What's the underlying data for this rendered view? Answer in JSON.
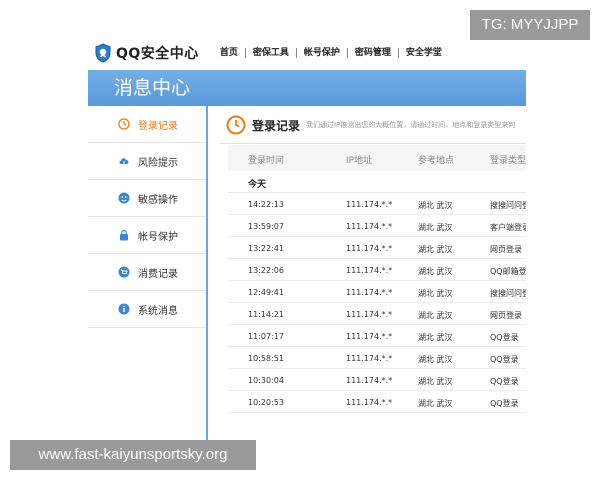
{
  "watermarks": {
    "top": "TG: MYYJJPP",
    "bottom": "www.fast-kaiyunsportsky.org"
  },
  "header": {
    "logo_text": "QQ安全中心",
    "nav": [
      "首页",
      "密保工具",
      "帐号保护",
      "密码管理",
      "安全学堂"
    ]
  },
  "banner": {
    "title": "消息中心"
  },
  "colors": {
    "accent": "#ee7a1a",
    "banner": "#5a98d8",
    "divider": "#6aa6e0"
  },
  "sidebar": {
    "items": [
      {
        "label": "登录记录",
        "icon": "clock-icon",
        "active": true
      },
      {
        "label": "风险提示",
        "icon": "cloud-icon",
        "active": false
      },
      {
        "label": "敏感操作",
        "icon": "face-icon",
        "active": false
      },
      {
        "label": "帐号保护",
        "icon": "lock-icon",
        "active": false
      },
      {
        "label": "消费记录",
        "icon": "cart-icon",
        "active": false
      },
      {
        "label": "系统消息",
        "icon": "info-icon",
        "active": false
      }
    ]
  },
  "main": {
    "title": "登录记录",
    "description": "我们通过IP推测出您的大概位置，请通过时间、地点和登录类型来判",
    "columns": [
      "登录时间",
      "IP地址",
      "参考地点",
      "登录类型"
    ],
    "group_label": "今天",
    "rows": [
      {
        "time": "14:22:13",
        "ip": "111.174.*.*",
        "place": "湖北 武汉",
        "type": "搜搜问问登"
      },
      {
        "time": "13:59:07",
        "ip": "111.174.*.*",
        "place": "湖北 武汉",
        "type": "客户端登录"
      },
      {
        "time": "13:22:41",
        "ip": "111.174.*.*",
        "place": "湖北 武汉",
        "type": "网页登录"
      },
      {
        "time": "13:22:06",
        "ip": "111.174.*.*",
        "place": "湖北 武汉",
        "type": "QQ邮箱登录"
      },
      {
        "time": "12:49:41",
        "ip": "111.174.*.*",
        "place": "湖北 武汉",
        "type": "搜搜问问登"
      },
      {
        "time": "11:14:21",
        "ip": "111.174.*.*",
        "place": "湖北 武汉",
        "type": "网页登录"
      },
      {
        "time": "11:07:17",
        "ip": "111.174.*.*",
        "place": "湖北 武汉",
        "type": "QQ登录"
      },
      {
        "time": "10:58:51",
        "ip": "111.174.*.*",
        "place": "湖北 武汉",
        "type": "QQ登录"
      },
      {
        "time": "10:30:04",
        "ip": "111.174.*.*",
        "place": "湖北 武汉",
        "type": "QQ登录"
      },
      {
        "time": "10:20:53",
        "ip": "111.174.*.*",
        "place": "湖北 武汉",
        "type": "QQ登录"
      }
    ]
  }
}
